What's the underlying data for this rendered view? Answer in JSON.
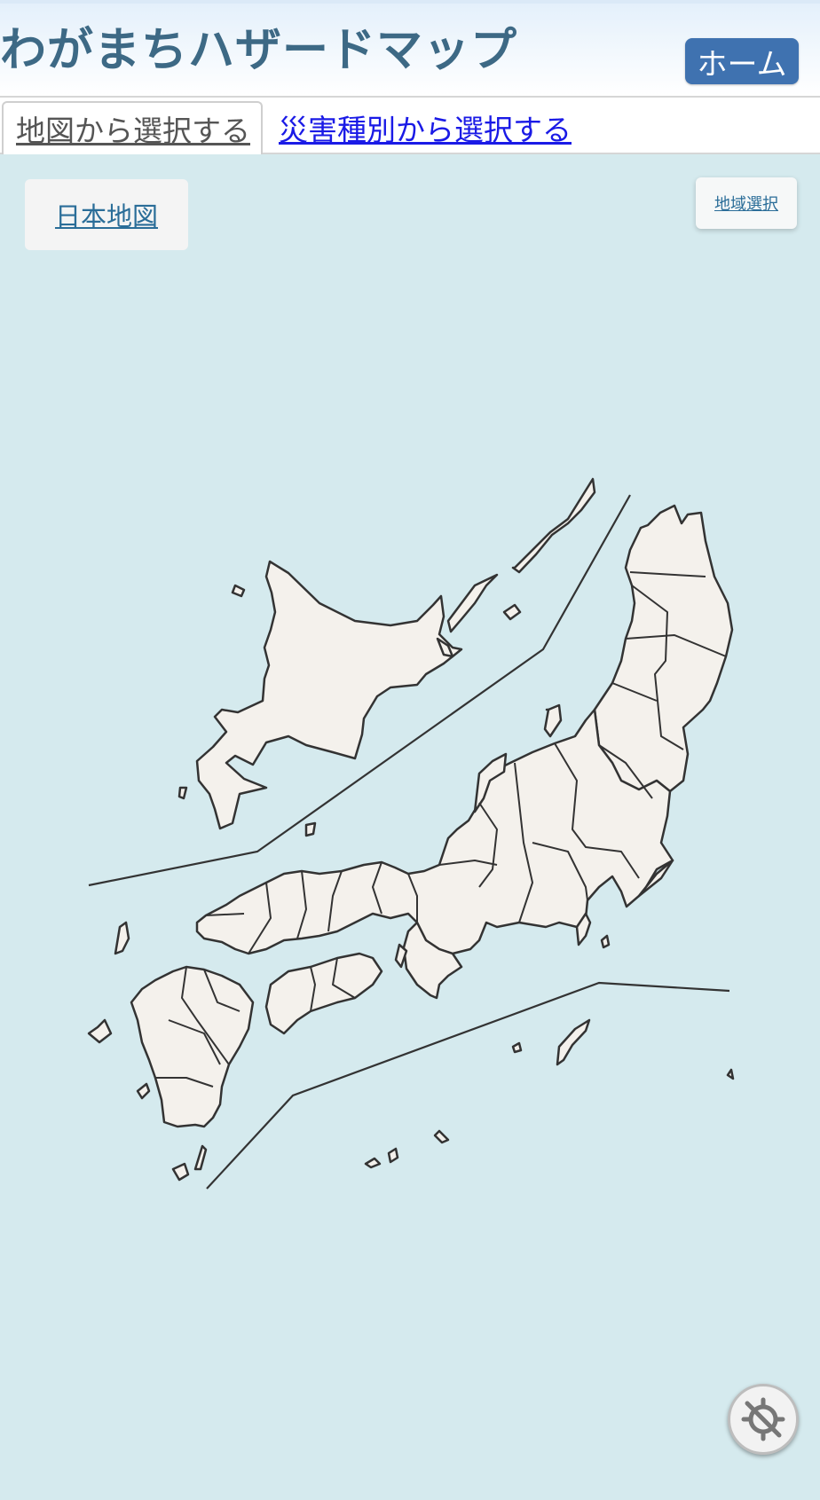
{
  "header": {
    "title": "わがまちハザードマップ",
    "home_label": "ホーム"
  },
  "tabs": [
    {
      "label": "地図から選択する",
      "active": true
    },
    {
      "label": "災害種別から選択する",
      "active": false
    }
  ],
  "map": {
    "japan_map_label": "日本地図",
    "region_select_label": "地域選択",
    "locate_icon": "crosshair-off-icon"
  },
  "colors": {
    "title": "#3d6985",
    "home_button": "#3f72b0",
    "sea": "#d5eaee",
    "land": "#f4f1ec",
    "link": "#2a6d98"
  }
}
